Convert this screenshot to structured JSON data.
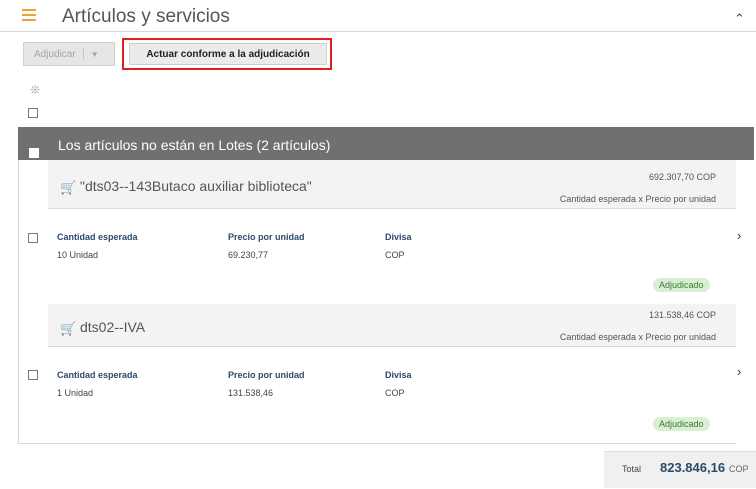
{
  "header": {
    "title": "Artículos y servicios",
    "list_icon": "list-icon",
    "collapse_icon": "chevron-up-icon"
  },
  "toolbar": {
    "adjudicar_label": "Adjudicar",
    "actuar_label": "Actuar conforme a la adjudicación",
    "highlight_color": "#e02020"
  },
  "group": {
    "title": "Los artículos no están en Lotes (2 artículos)"
  },
  "labels": {
    "cantidad": "Cantidad esperada",
    "precio": "Precio por unidad",
    "divisa": "Divisa"
  },
  "items": [
    {
      "name": "\"dts03--143Butaco auxiliar biblioteca\"",
      "total": "692.307,70 COP",
      "formula": "Cantidad esperada x Precio por unidad",
      "cantidad": "10 Unidad",
      "precio": "69.230,77",
      "divisa": "COP",
      "status": "Adjudicado"
    },
    {
      "name": "dts02--IVA",
      "total": "131.538,46 COP",
      "formula": "Cantidad esperada x Precio por unidad",
      "cantidad": "1 Unidad",
      "precio": "131.538,46",
      "divisa": "COP",
      "status": "Adjudicado"
    }
  ],
  "footer": {
    "total_label": "Total",
    "total_value": "823.846,16",
    "currency": "COP"
  },
  "colors": {
    "badge_bg": "#d8efd4",
    "badge_text": "#3a7a36",
    "group_bar": "#707070",
    "accent": "#f0a030"
  }
}
